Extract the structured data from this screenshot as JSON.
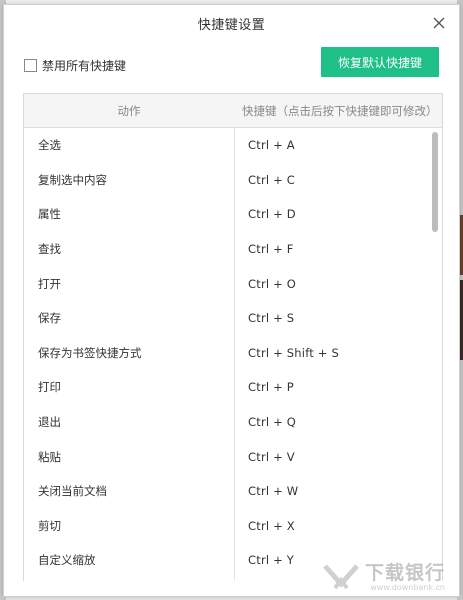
{
  "dialog": {
    "title": "快捷键设置",
    "disable_all_label": "禁用所有快捷键",
    "restore_button_label": "恢复默认快捷键"
  },
  "table": {
    "headers": {
      "action": "动作",
      "shortcut": "快捷键（点击后按下快捷键即可修改）"
    },
    "rows": [
      {
        "action": "全选",
        "key": "Ctrl + A"
      },
      {
        "action": "复制选中内容",
        "key": "Ctrl + C"
      },
      {
        "action": "属性",
        "key": "Ctrl + D"
      },
      {
        "action": "查找",
        "key": "Ctrl + F"
      },
      {
        "action": "打开",
        "key": "Ctrl + O"
      },
      {
        "action": "保存",
        "key": "Ctrl + S"
      },
      {
        "action": "保存为书签快捷方式",
        "key": "Ctrl + Shift + S"
      },
      {
        "action": "打印",
        "key": "Ctrl + P"
      },
      {
        "action": "退出",
        "key": "Ctrl + Q"
      },
      {
        "action": "粘贴",
        "key": "Ctrl + V"
      },
      {
        "action": "关闭当前文档",
        "key": "Ctrl + W"
      },
      {
        "action": "剪切",
        "key": "Ctrl + X"
      },
      {
        "action": "自定义缩放",
        "key": "Ctrl + Y"
      }
    ]
  },
  "watermark": {
    "text_cn": "下载银行",
    "text_en": "www.downbank.cn"
  },
  "colors": {
    "accent": "#1fbf88"
  },
  "icons": {
    "close": "close-icon",
    "watermark_logo": "downbank-logo-icon"
  }
}
